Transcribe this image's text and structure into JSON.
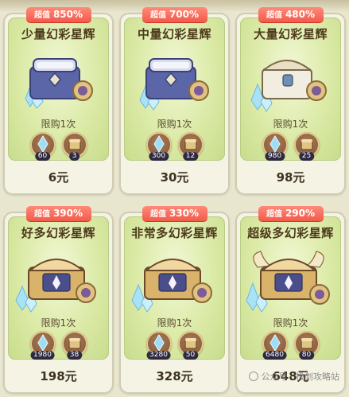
{
  "badge_prefix": "超值",
  "limit_text": "限购1次",
  "watermark": "公众号 · 极剑攻略站",
  "cards": [
    {
      "badge_pct": "850%",
      "title": "少量幻彩星辉",
      "crystal_count": "60",
      "chest_count": "3",
      "price": "6元",
      "chest_style": "steel"
    },
    {
      "badge_pct": "700%",
      "title": "中量幻彩星辉",
      "crystal_count": "300",
      "chest_count": "12",
      "price": "30元",
      "chest_style": "steel"
    },
    {
      "badge_pct": "480%",
      "title": "大量幻彩星辉",
      "crystal_count": "980",
      "chest_count": "25",
      "price": "98元",
      "chest_style": "pearl"
    },
    {
      "badge_pct": "390%",
      "title": "好多幻彩星辉",
      "crystal_count": "1980",
      "chest_count": "38",
      "price": "198元",
      "chest_style": "gold"
    },
    {
      "badge_pct": "330%",
      "title": "非常多幻彩星辉",
      "crystal_count": "3280",
      "chest_count": "50",
      "price": "328元",
      "chest_style": "gold"
    },
    {
      "badge_pct": "290%",
      "title": "超级多幻彩星辉",
      "crystal_count": "6480",
      "chest_count": "80",
      "price": "648元",
      "chest_style": "gold-wings"
    }
  ],
  "colors": {
    "badge": "#f25a4a",
    "card_green": "#dbeaa6",
    "crystal": "#8fd2f0",
    "steel_chest": "#5b66a8",
    "gold_chest": "#d9b36a"
  }
}
